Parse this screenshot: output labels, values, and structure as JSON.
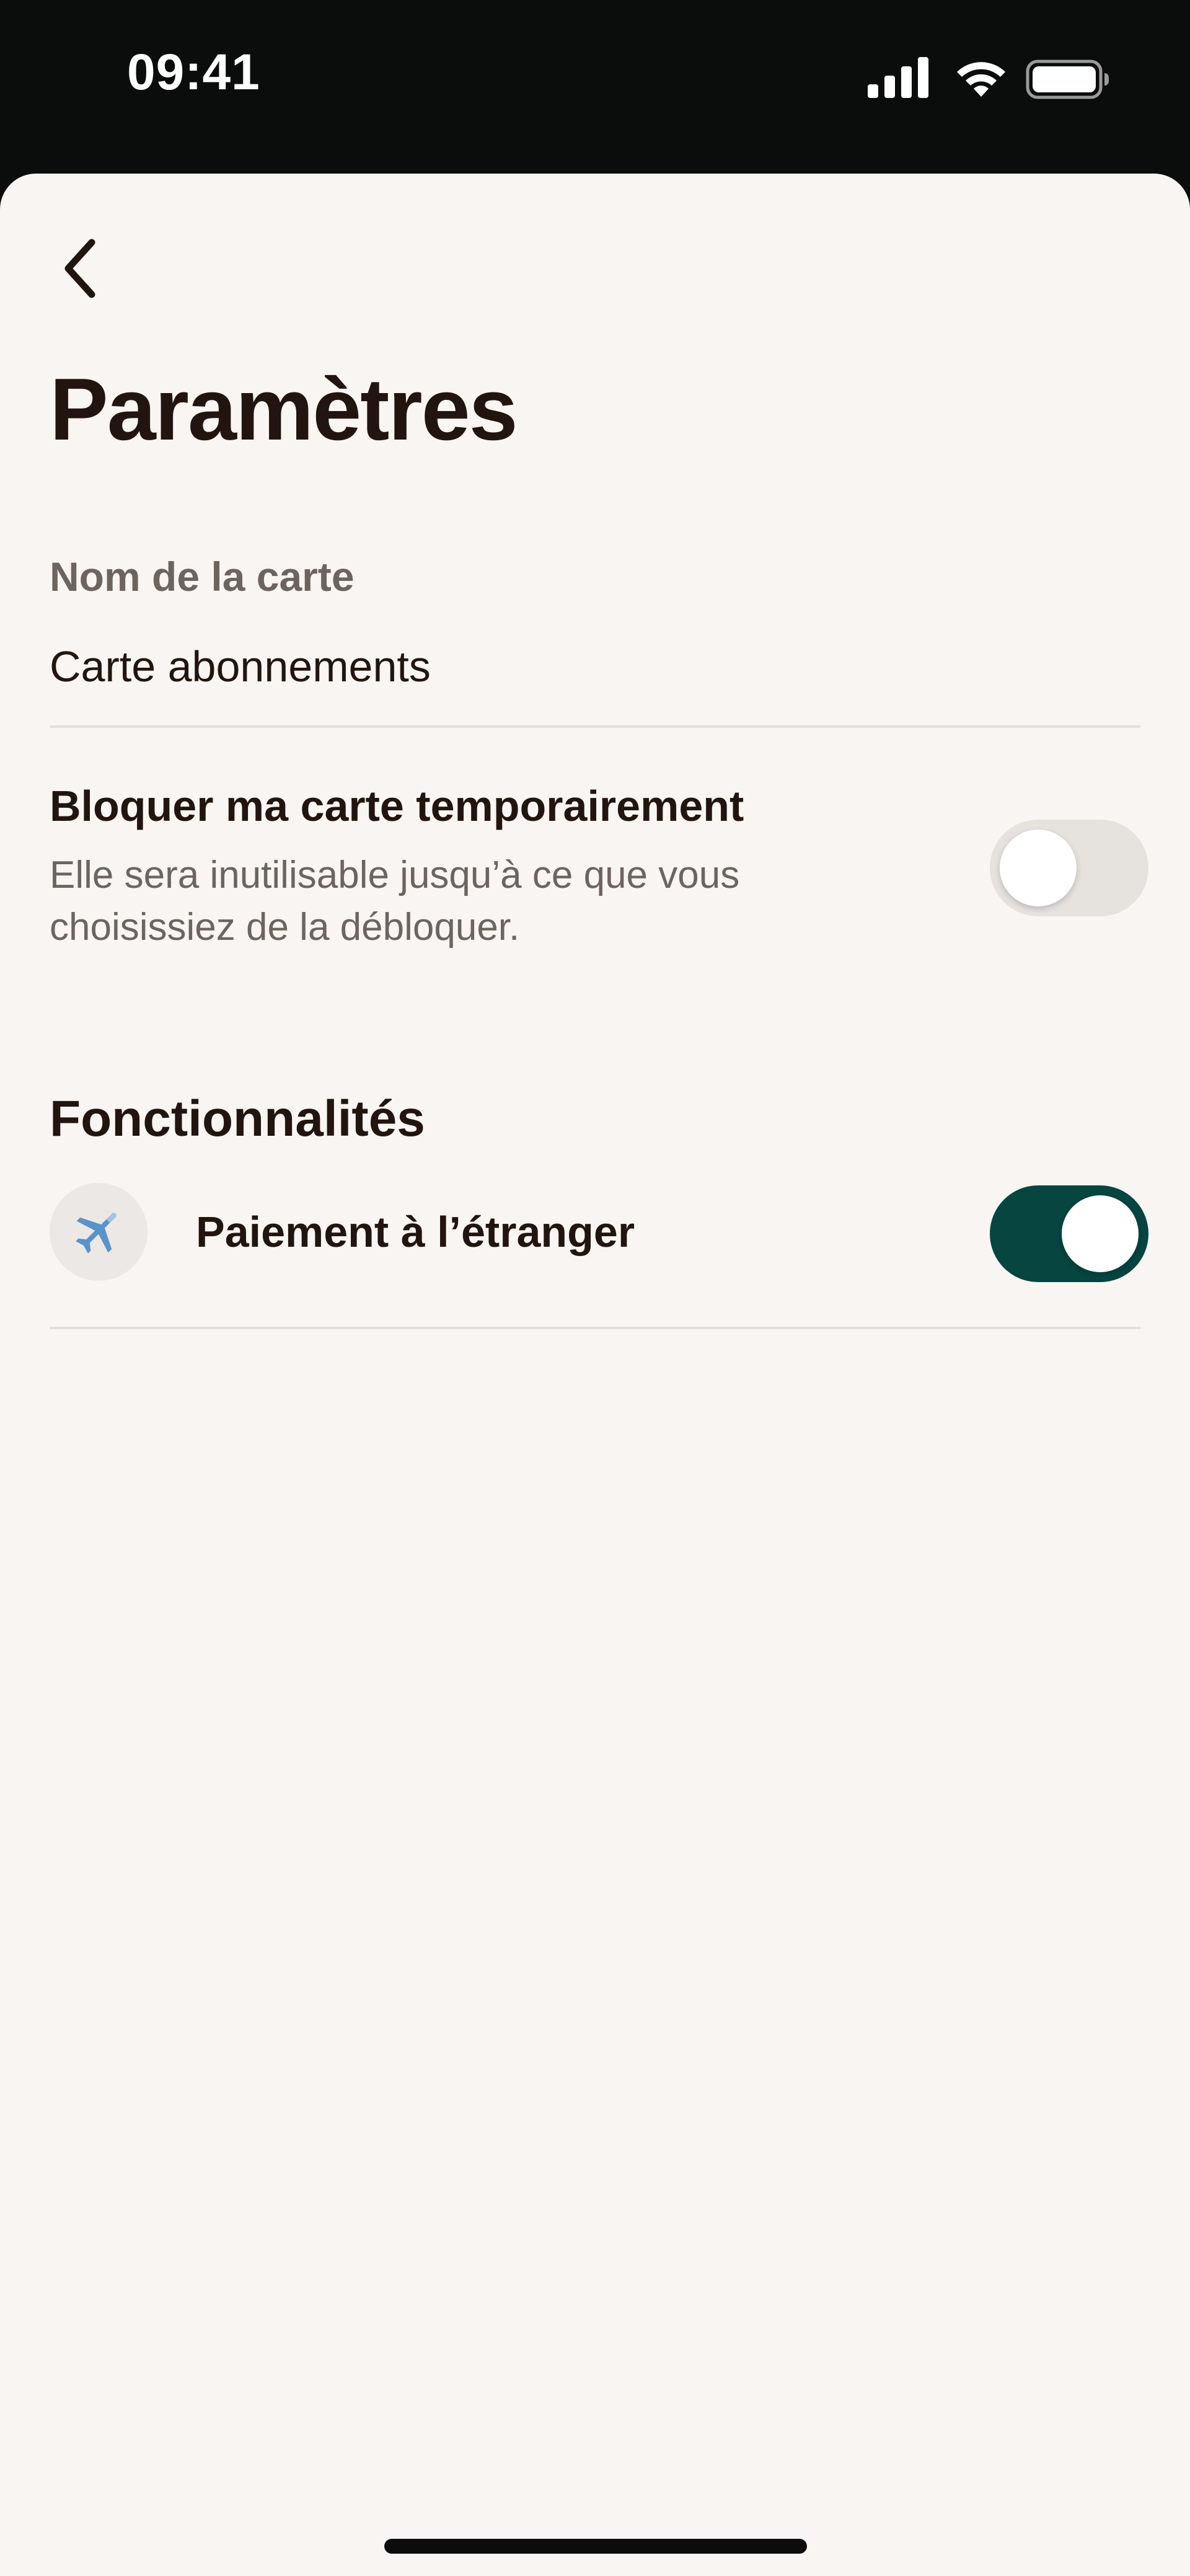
{
  "status_bar": {
    "time": "09:41",
    "icons": [
      "cellular-signal-icon",
      "wifi-icon",
      "battery-icon"
    ]
  },
  "header": {
    "back_icon": "chevron-left-icon",
    "title": "Paramètres"
  },
  "card_name": {
    "label": "Nom de la carte",
    "value": "Carte abonnements"
  },
  "block_card": {
    "title": "Bloquer ma carte temporairement",
    "description": "Elle sera inutilisable jusqu’à ce que vous choisissiez de la débloquer.",
    "enabled": false
  },
  "features": {
    "title": "Fonctionnalités",
    "items": [
      {
        "icon": "airplane-icon",
        "label": "Paiement à l’étranger",
        "enabled": true
      }
    ]
  },
  "colors": {
    "background": "#f8f5f2",
    "status_bar": "#0a0d0b",
    "text_primary": "#22150f",
    "text_secondary": "#6d6460",
    "toggle_on": "#064540",
    "toggle_off": "#e6e2de"
  }
}
